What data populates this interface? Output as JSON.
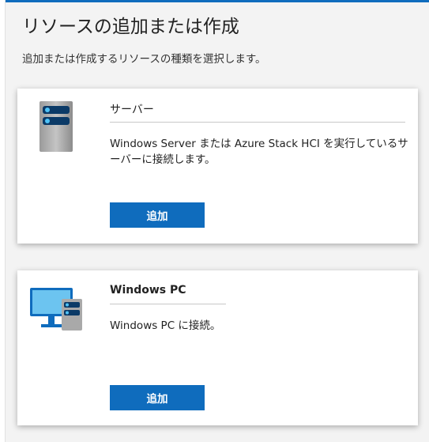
{
  "header": {
    "title": "リソースの追加または作成",
    "subtitle": "追加または作成するリソースの種類を選択します。"
  },
  "cards": [
    {
      "icon": "server-icon",
      "title": "サーバー",
      "description": "Windows Server または Azure Stack HCI を実行しているサーバーに接続します。",
      "button_label": "追加"
    },
    {
      "icon": "windows-pc-icon",
      "title": "Windows PC",
      "description": "Windows PC に接続。",
      "button_label": "追加"
    }
  ],
  "colors": {
    "accent": "#0f6cbd",
    "background": "#f3f3f3",
    "card": "#ffffff"
  }
}
